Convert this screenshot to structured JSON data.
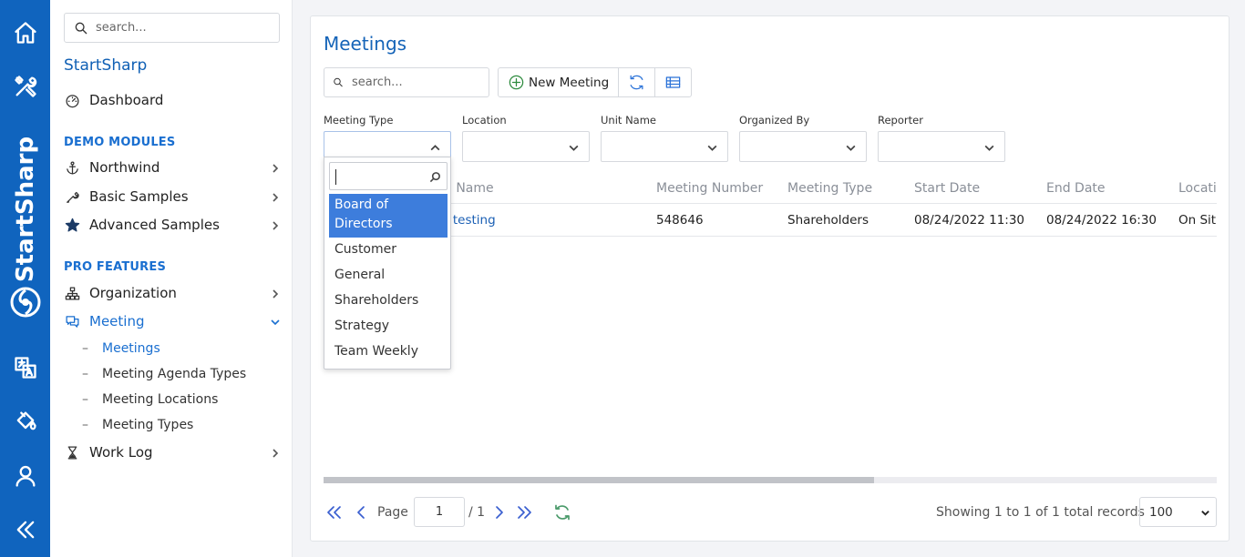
{
  "rail": {
    "brand": "StartSharp",
    "icons": [
      "home-icon",
      "tools-icon",
      "translate-icon",
      "paint-bucket-icon",
      "user-icon",
      "collapse-icon"
    ]
  },
  "sidebar": {
    "search_placeholder": "search...",
    "app_title": "StartSharp",
    "dashboard": "Dashboard",
    "demo_modules_label": "DEMO MODULES",
    "northwind": "Northwind",
    "basic_samples": "Basic Samples",
    "advanced_samples": "Advanced Samples",
    "pro_features_label": "PRO FEATURES",
    "organization": "Organization",
    "meeting": "Meeting",
    "meeting_children": [
      "Meetings",
      "Meeting Agenda Types",
      "Meeting Locations",
      "Meeting Types"
    ],
    "work_log": "Work Log"
  },
  "main": {
    "title": "Meetings",
    "search_placeholder": "search...",
    "new_button": "New Meeting",
    "filters": {
      "meeting_type": "Meeting Type",
      "location": "Location",
      "unit_name": "Unit Name",
      "organized_by": "Organized By",
      "reporter": "Reporter"
    },
    "columns": {
      "name": "g Name",
      "number": "Meeting Number",
      "type": "Meeting Type",
      "start": "Start Date",
      "end": "End Date",
      "location": "Locati"
    },
    "row": {
      "name": "r testing",
      "number": "548646",
      "type": "Shareholders",
      "start": "08/24/2022 11:30",
      "end": "08/24/2022 16:30",
      "location": "On Sit"
    },
    "pager": {
      "page_label": "Page",
      "page_value": "1",
      "page_total": "/ 1",
      "status": "Showing 1 to 1 of 1 total records",
      "page_size": "100"
    }
  },
  "dropdown": {
    "options": [
      "Board of Directors",
      "Customer",
      "General",
      "Shareholders",
      "Strategy",
      "Team Weekly"
    ],
    "selected": "Board of Directors"
  },
  "colors": {
    "accent": "#1064be",
    "link": "#1a6fd0",
    "selected": "#3d7ddc"
  }
}
